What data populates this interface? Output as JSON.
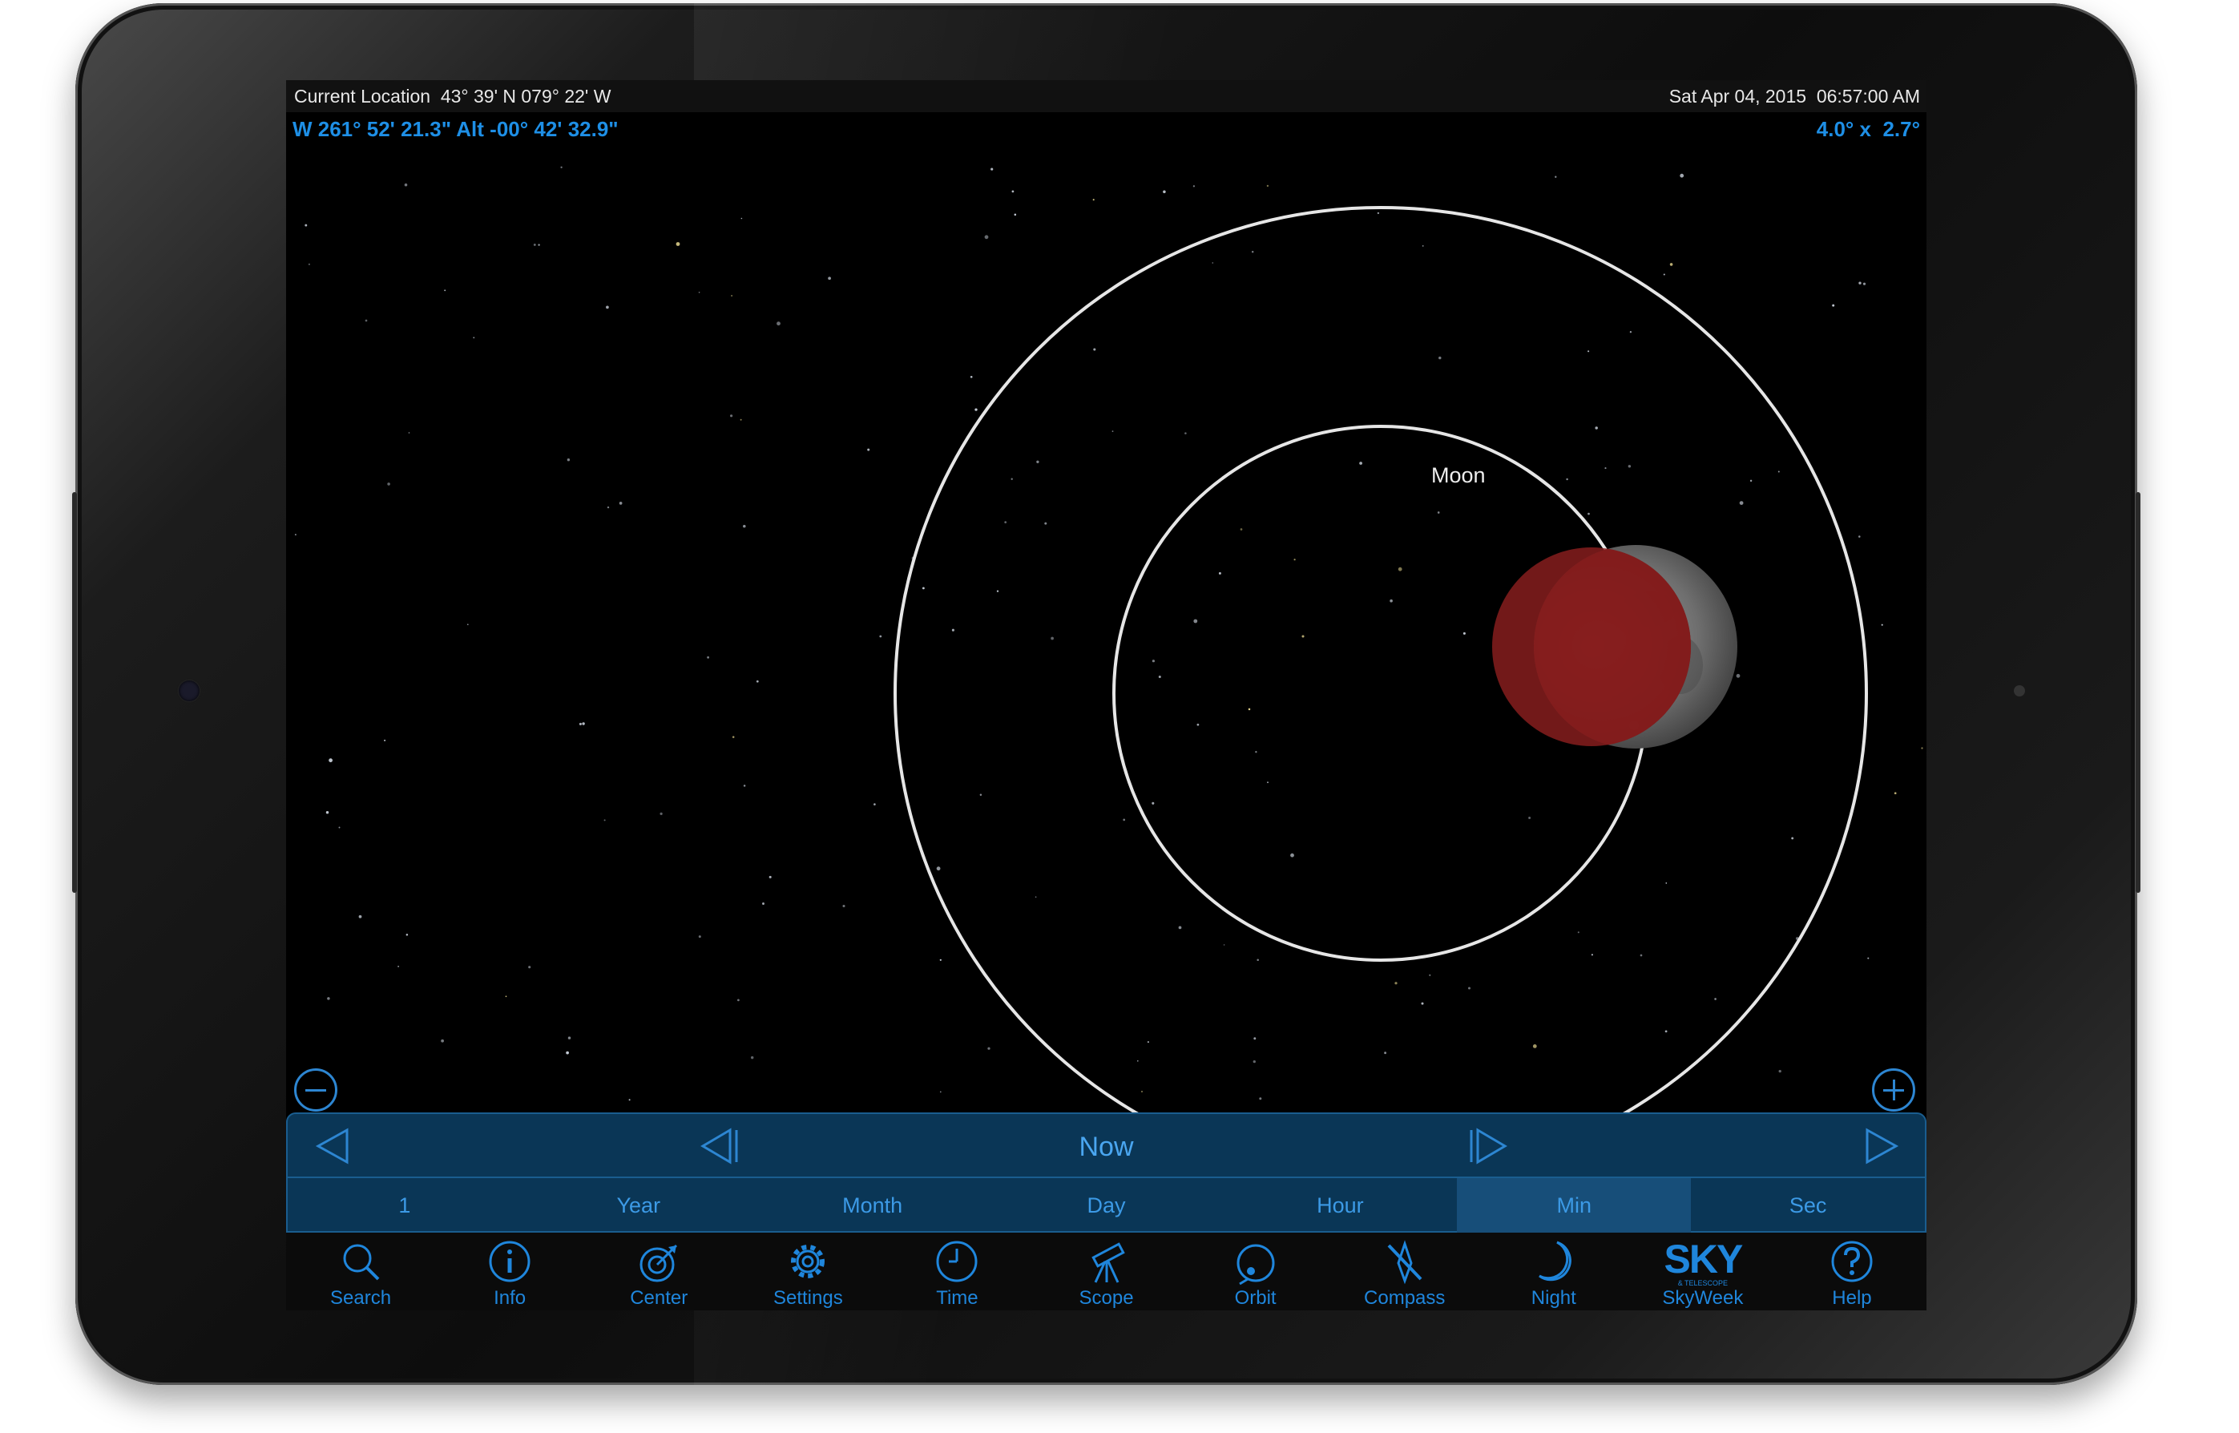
{
  "status": {
    "location_label": "Current Location",
    "location_value": "43° 39' N 079° 22' W",
    "datetime": "Sat Apr 04, 2015  06:57:00 AM"
  },
  "readouts": {
    "coordinates": "W 261° 52' 21.3\" Alt -00° 42' 32.9\"",
    "field_of_view": "4.0° x  2.7°"
  },
  "sky": {
    "object_label": "Moon"
  },
  "time_control": {
    "now_label": "Now",
    "units": [
      "1",
      "Year",
      "Month",
      "Day",
      "Hour",
      "Min",
      "Sec"
    ],
    "active_unit": "Min"
  },
  "toolbar": [
    {
      "label": "Search",
      "icon": "search-icon"
    },
    {
      "label": "Info",
      "icon": "info-icon"
    },
    {
      "label": "Center",
      "icon": "center-icon"
    },
    {
      "label": "Settings",
      "icon": "gear-icon"
    },
    {
      "label": "Time",
      "icon": "clock-icon"
    },
    {
      "label": "Scope",
      "icon": "telescope-icon"
    },
    {
      "label": "Orbit",
      "icon": "orbit-icon"
    },
    {
      "label": "Compass",
      "icon": "compass-icon"
    },
    {
      "label": "Night",
      "icon": "moon-crescent-icon"
    },
    {
      "label": "SkyWeek",
      "icon": "sky-logo-icon",
      "logo_text": "SKY",
      "logo_subtext": "& TELESCOPE"
    },
    {
      "label": "Help",
      "icon": "help-icon"
    }
  ],
  "colors": {
    "accent": "#1f86dc",
    "panel": "#0a3656",
    "umbra": "#8b1e1e"
  }
}
